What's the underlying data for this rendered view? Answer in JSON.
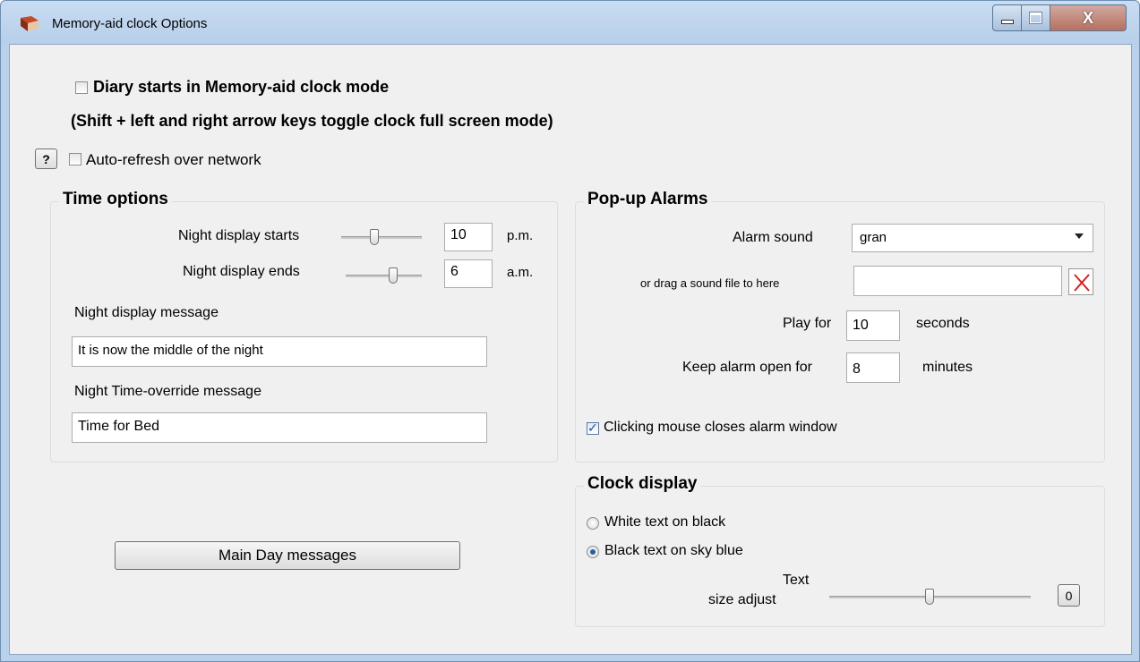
{
  "window": {
    "title": "Memory-aid clock Options",
    "app_icon": "book-icon",
    "minimize_icon": "minimize-icon",
    "maximize_icon": "maximize-icon",
    "close_label": "X"
  },
  "top": {
    "diary_checkbox_label": "Diary starts in Memory-aid clock mode",
    "diary_checked": false,
    "hint": "(Shift + left and right arrow keys toggle clock full screen mode)",
    "help_button_label": "?",
    "autorefresh_label": "Auto-refresh over network",
    "autorefresh_checked": false
  },
  "time_options": {
    "title": "Time options",
    "night_starts_label": "Night display starts",
    "night_starts_value": "10",
    "night_starts_unit": "p.m.",
    "night_ends_label": "Night display ends",
    "night_ends_value": "6",
    "night_ends_unit": "a.m.",
    "night_message_label": "Night display message",
    "night_message_value": "It is now the middle of the night",
    "override_label": "Night Time-override message",
    "override_value": "Time for Bed"
  },
  "main_day_button": "Main Day messages",
  "popup_alarms": {
    "title": "Pop-up Alarms",
    "alarm_sound_label": "Alarm sound",
    "alarm_sound_value": "gran",
    "drag_label": "or drag a sound file to here",
    "drag_value": "",
    "clear_icon": "red-x-icon",
    "play_for_label": "Play for",
    "play_for_value": "10",
    "play_for_unit": "seconds",
    "keep_open_label": "Keep alarm open for",
    "keep_open_value": "8",
    "keep_open_unit": "minutes",
    "clicking_label": "Clicking mouse closes alarm window",
    "clicking_checked": true
  },
  "clock_display": {
    "title": "Clock display",
    "option_white": "White text on black",
    "option_black": "Black text on sky blue",
    "selected": "Black text on sky blue",
    "text_label_1": "Text",
    "text_label_2": "size adjust",
    "size_value": "0"
  },
  "colors": {
    "titlebar": "#c9dcf2",
    "client_bg": "#f0f0f0",
    "close_button": "#b6705f",
    "clear_x": "#d42020"
  }
}
